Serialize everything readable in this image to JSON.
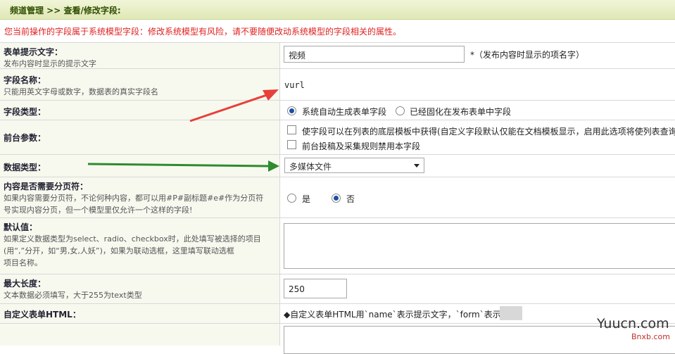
{
  "header": {
    "breadcrumb": "频道管理 >> 查看/修改字段:"
  },
  "warning": "您当前操作的字段属于系统模型字段：修改系统模型有风险，请不要随便改动系统模型的字段相关的属性。",
  "rows": {
    "tip": {
      "title": "表单提示文字：",
      "desc": "发布内容时显示的提示文字",
      "value": "视频",
      "note": "*（发布内容时显示的项名字）"
    },
    "fieldname": {
      "title": "字段名称：",
      "desc": "只能用英文字母或数字，数据表的真实字段名",
      "value": "vurl"
    },
    "fieldtype": {
      "title": "字段类型：",
      "opt1": "系统自动生成表单字段",
      "opt2": "已经固化在发布表单中字段"
    },
    "front": {
      "title": "前台参数：",
      "opt1": "使字段可以在列表的底层模板中获得(自定义字段默认仅能在文档模板显示，启用此选项将使列表查询",
      "opt2": "前台投稿及采集规则禁用本字段"
    },
    "datatype": {
      "title": "数据类型：",
      "selected": "多媒体文件"
    },
    "paging": {
      "title": "内容是否需要分页符：",
      "desc1": "如果内容需要分页符，不论何种内容，都可以用#P#副标题#e#作为分页符",
      "desc2": "号实现内容分页，但一个模型里仅允许一个这样的字段!",
      "yes": "是",
      "no": "否"
    },
    "default": {
      "title": "默认值：",
      "desc1": "如果定义数据类型为select、radio、checkbox时，此处填写被选择的项目",
      "desc2": "(用“,”分开，如“男,女,人妖”)，如果为联动选框，这里填写联动选框",
      "desc3": "项目名称。"
    },
    "maxlen": {
      "title": "最大长度：",
      "desc": "文本数据必须填写，大于255为text类型",
      "value": "250"
    },
    "custom": {
      "title": "自定义表单HTML：",
      "note": "◆自定义表单HTML用`name`表示提示文字，`form`表示表单"
    }
  },
  "watermark": {
    "main": "Yuucn.com",
    "sub": "Bnxb.com"
  },
  "colors": {
    "red_arrow": "#e8403a",
    "green_arrow": "#2e8b2e"
  }
}
